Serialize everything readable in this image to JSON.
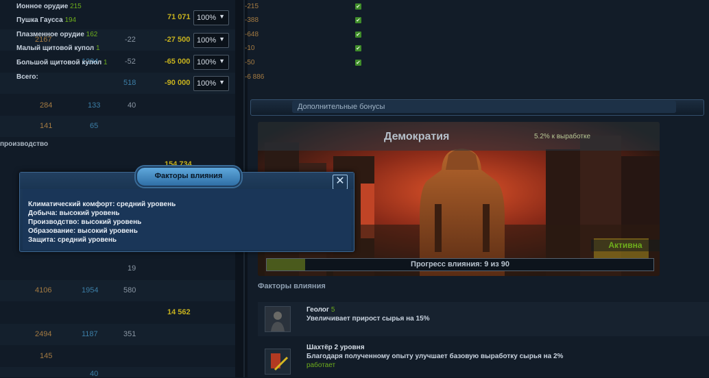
{
  "left_table": {
    "rows": [
      {
        "c1": "",
        "c2": "",
        "c3": "",
        "c4": "71 071",
        "pct": "100%"
      },
      {
        "c1": "2167",
        "c2": "",
        "c3": "-22",
        "c4": "-27 500",
        "pct": "100%"
      },
      {
        "c1": "",
        "c2": "1294",
        "c3": "-52",
        "c4": "-65 000",
        "pct": "100%"
      },
      {
        "c1": "",
        "c2": "",
        "c3": "518",
        "c4": "-90 000",
        "pct": "100%"
      },
      {
        "c1": "284",
        "c2": "133",
        "c3": "40",
        "c4": "",
        "pct": ""
      },
      {
        "c1": "141",
        "c2": "65",
        "c3": "",
        "c4": "",
        "pct": ""
      }
    ],
    "section_label": "производство",
    "section_total": "154 734",
    "lower_rows": [
      {
        "c1": "",
        "c2": "",
        "c3": "19",
        "c4": ""
      },
      {
        "c1": "4106",
        "c2": "1954",
        "c3": "580",
        "c4": ""
      },
      {
        "c1": "",
        "c2": "",
        "c3": "",
        "c4": "14 562"
      },
      {
        "c1": "2494",
        "c2": "1187",
        "c3": "351",
        "c4": ""
      },
      {
        "c1": "145",
        "c2": "",
        "c3": "",
        "c4": ""
      }
    ],
    "partial_value": "40"
  },
  "defense": {
    "rows": [
      {
        "name": "Ионное орудие",
        "count": "215",
        "value": "-215"
      },
      {
        "name": "Пушка Гаусса",
        "count": "194",
        "value": "-388"
      },
      {
        "name": "Плазменное орудие",
        "count": "162",
        "value": "-648"
      },
      {
        "name": "Малый щитовой купол",
        "count": "1",
        "value": "-10"
      },
      {
        "name": "Большой щитовой купол",
        "count": "1",
        "value": "-50"
      }
    ],
    "total_label": "Всего:",
    "total_value": "-6 886",
    "check_glyph": "✔"
  },
  "bonuses": {
    "header": "Дополнительные бонусы",
    "gov_title": "Демократия",
    "gov_bonus": "5.2% к выработке",
    "gov_status": "Активна",
    "progress_text": "Прогресс влияния: 9 из 90",
    "progress_fraction": 0.1
  },
  "factors": {
    "heading": "Факторы влияния",
    "items": [
      {
        "title": "Геолог",
        "count": "5",
        "desc": "Увеличивает прирост сырья на 15%",
        "status": ""
      },
      {
        "title": "Шахтёр 2 уровня",
        "count": "",
        "desc": "Благодаря полученному опыту улучшает базовую выработку сырья на 2%",
        "status": "работает"
      }
    ]
  },
  "popup": {
    "title": "Факторы влияния",
    "close_glyph": "✕",
    "lines": [
      "Климатический комфорт: средний уровень",
      "Добыча: высокий уровень",
      "Производство: высокий уровень",
      "Образование: высокий уровень",
      "Защита: средний уровень"
    ]
  },
  "colors": {
    "accent": "#5fa8dc",
    "positive": "#6eae1c",
    "highlight": "#c7b21e",
    "negative": "#a57b42"
  }
}
